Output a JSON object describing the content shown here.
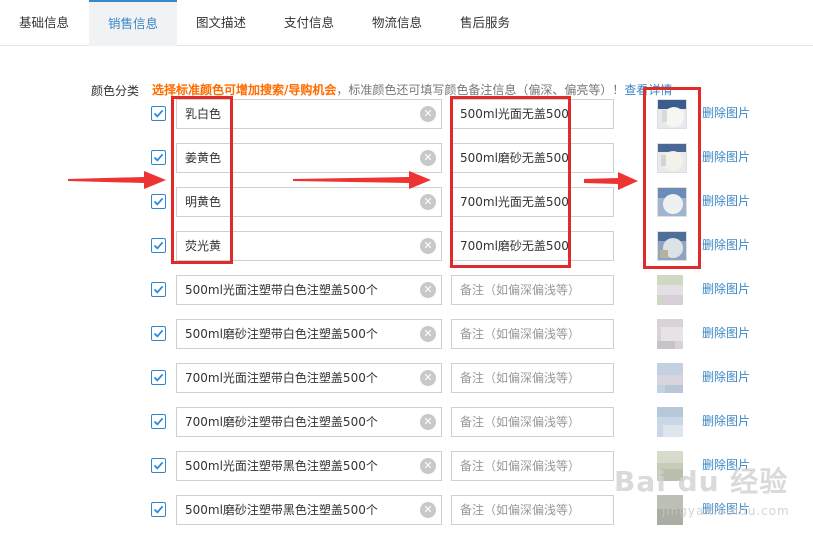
{
  "tabs": [
    {
      "label": "基础信息",
      "active": false
    },
    {
      "label": "销售信息",
      "active": true
    },
    {
      "label": "图文描述",
      "active": false
    },
    {
      "label": "支付信息",
      "active": false
    },
    {
      "label": "物流信息",
      "active": false
    },
    {
      "label": "售后服务",
      "active": false
    }
  ],
  "color_section": {
    "label": "颜色分类",
    "notice_highlight": "选择标准颜色可增加搜索/导购机会",
    "notice_text": "，标准颜色还可填写颜色备注信息（偏深、偏亮等）！",
    "notice_link": "查看详情"
  },
  "rows": [
    {
      "name": "乳白色",
      "note": "500ml光面无盖500",
      "note_placeholder": "",
      "delete_label": "删除图片",
      "checked": true
    },
    {
      "name": "姜黄色",
      "note": "500ml磨砂无盖500",
      "note_placeholder": "",
      "delete_label": "删除图片",
      "checked": true
    },
    {
      "name": "明黄色",
      "note": "700ml光面无盖500",
      "note_placeholder": "",
      "delete_label": "删除图片",
      "checked": true
    },
    {
      "name": "荧光黄",
      "note": "700ml磨砂无盖500",
      "note_placeholder": "",
      "delete_label": "删除图片",
      "checked": true
    },
    {
      "name": "500ml光面注塑带白色注塑盖500个",
      "note": "",
      "note_placeholder": "备注（如偏深偏浅等）",
      "delete_label": "删除图片",
      "checked": true
    },
    {
      "name": "500ml磨砂注塑带白色注塑盖500个",
      "note": "",
      "note_placeholder": "备注（如偏深偏浅等）",
      "delete_label": "删除图片",
      "checked": true
    },
    {
      "name": "700ml光面注塑带白色注塑盖500个",
      "note": "",
      "note_placeholder": "备注（如偏深偏浅等）",
      "delete_label": "删除图片",
      "checked": true
    },
    {
      "name": "700ml磨砂注塑带白色注塑盖500个",
      "note": "",
      "note_placeholder": "备注（如偏深偏浅等）",
      "delete_label": "删除图片",
      "checked": true
    },
    {
      "name": "500ml光面注塑带黑色注塑盖500个",
      "note": "",
      "note_placeholder": "备注（如偏深偏浅等）",
      "delete_label": "删除图片",
      "checked": true
    },
    {
      "name": "500ml磨砂注塑带黑色注塑盖500个",
      "note": "",
      "note_placeholder": "备注（如偏深偏浅等）",
      "delete_label": "删除图片",
      "checked": true
    }
  ],
  "icons": {
    "checkbox": "checkmark-icon",
    "clear": "clear-circle-icon",
    "thumbnail": "product-thumbnail"
  },
  "colors": {
    "accent": "#3a87c6",
    "notice": "#ff6c00",
    "annotation": "#e12a2a"
  },
  "watermark": {
    "main": "Bai du 经验",
    "sub": "jingyan.baidu.com"
  }
}
